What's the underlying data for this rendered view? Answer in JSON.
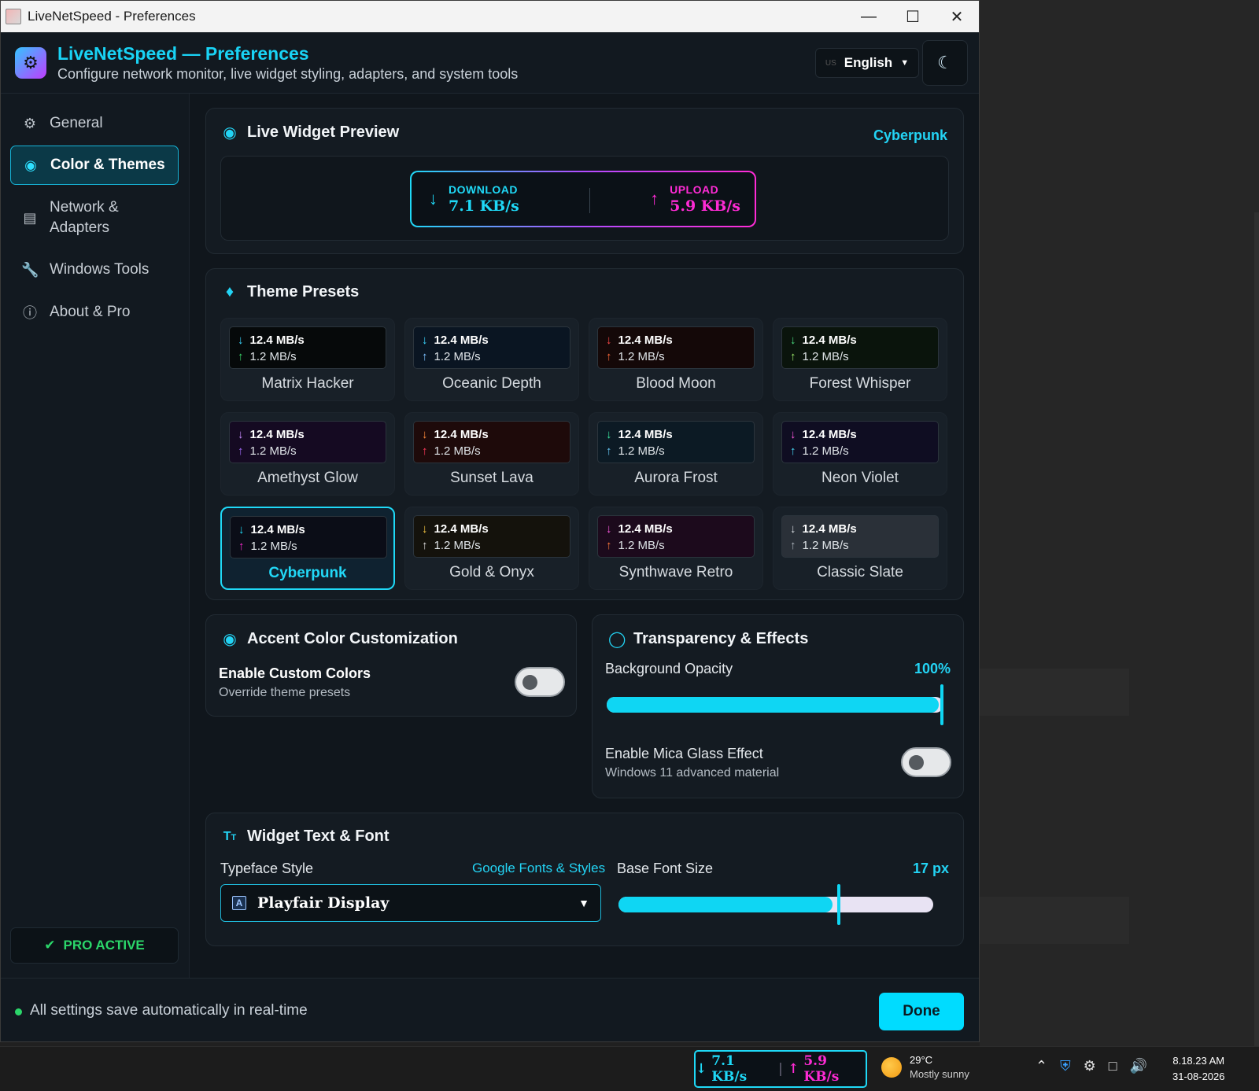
{
  "window": {
    "title": "LiveNetSpeed - Preferences"
  },
  "header": {
    "title": "LiveNetSpeed — Preferences",
    "subtitle": "Configure network monitor, live widget styling, adapters, and system tools",
    "language_flag": "US",
    "language": "English"
  },
  "sidebar": {
    "items": [
      {
        "label": "General",
        "icon": "gear-icon"
      },
      {
        "label": "Color & Themes",
        "icon": "palette-icon"
      },
      {
        "label": "Network & Adapters",
        "icon": "router-icon"
      },
      {
        "label": "Windows Tools",
        "icon": "wrench-icon"
      },
      {
        "label": "About & Pro",
        "icon": "info-icon"
      }
    ],
    "pro_label": "PRO ACTIVE"
  },
  "preview": {
    "title": "Live Widget Preview",
    "theme_badge": "Cyberpunk",
    "download_label": "DOWNLOAD",
    "download_value": "7.1 KB/s",
    "upload_label": "UPLOAD",
    "upload_value": "5.9 KB/s"
  },
  "presets": {
    "title": "Theme Presets",
    "down_value": "12.4 MB/s",
    "up_value": "1.2 MB/s",
    "items": [
      {
        "name": "Matrix Hacker",
        "bg": "#06090a",
        "down": "#3ad6ff",
        "up": "#3ad66a"
      },
      {
        "name": "Oceanic Depth",
        "bg": "#0a1522",
        "down": "#3ad6ff",
        "up": "#7cc0ff"
      },
      {
        "name": "Blood Moon",
        "bg": "#140808",
        "down": "#ff4a4a",
        "up": "#ff6a3a"
      },
      {
        "name": "Forest Whisper",
        "bg": "#0a140c",
        "down": "#4ade80",
        "up": "#9be86a"
      },
      {
        "name": "Amethyst Glow",
        "bg": "#150a22",
        "down": "#c98cff",
        "up": "#a46cff"
      },
      {
        "name": "Sunset Lava",
        "bg": "#1e0a0a",
        "down": "#ff8a3a",
        "up": "#ff3a5a"
      },
      {
        "name": "Aurora Frost",
        "bg": "#0c1a24",
        "down": "#3ae8a0",
        "up": "#6ad0ff"
      },
      {
        "name": "Neon Violet",
        "bg": "#0f0d22",
        "down": "#ff5ae0",
        "up": "#4ae0ff"
      },
      {
        "name": "Cyberpunk",
        "bg": "#0b0d17",
        "down": "#1fd9f7",
        "up": "#ff2bd5"
      },
      {
        "name": "Gold & Onyx",
        "bg": "#14120c",
        "down": "#f5c542",
        "up": "#d9d9d9"
      },
      {
        "name": "Synthwave Retro",
        "bg": "#1c0a1c",
        "down": "#ff5ae0",
        "up": "#ff7a3a"
      },
      {
        "name": "Classic Slate",
        "bg": "#2a3038",
        "down": "#d9dde2",
        "up": "#aab2ba"
      }
    ],
    "selected_index": 8
  },
  "accent": {
    "title": "Accent Color Customization",
    "toggle_label": "Enable Custom Colors",
    "toggle_sub": "Override theme presets",
    "enabled": false
  },
  "effects": {
    "title": "Transparency & Effects",
    "opacity_label": "Background Opacity",
    "opacity_value": "100%",
    "opacity_fraction": 1.0,
    "mica_label": "Enable Mica Glass Effect",
    "mica_sub": "Windows 11 advanced material",
    "mica_enabled": false
  },
  "font": {
    "title": "Widget Text & Font",
    "typeface_label": "Typeface Style",
    "typeface_link": "Google Fonts & Styles",
    "typeface_value": "Playfair Display",
    "size_label": "Base Font Size",
    "size_value": "17 px",
    "size_fraction": 0.7
  },
  "footer": {
    "message": "All settings save automatically in real-time",
    "done_label": "Done"
  },
  "taskbar": {
    "down": "7.1 KB/s",
    "up": "5.9 KB/s",
    "temperature": "29°C",
    "weather": "Mostly sunny",
    "time": "8.18.23 AM",
    "date": "31-08-2026"
  },
  "colors": {
    "accent": "#1fd9f7",
    "download": "#1fd9f7",
    "upload": "#ff2bd5",
    "pro": "#2bd66a"
  }
}
